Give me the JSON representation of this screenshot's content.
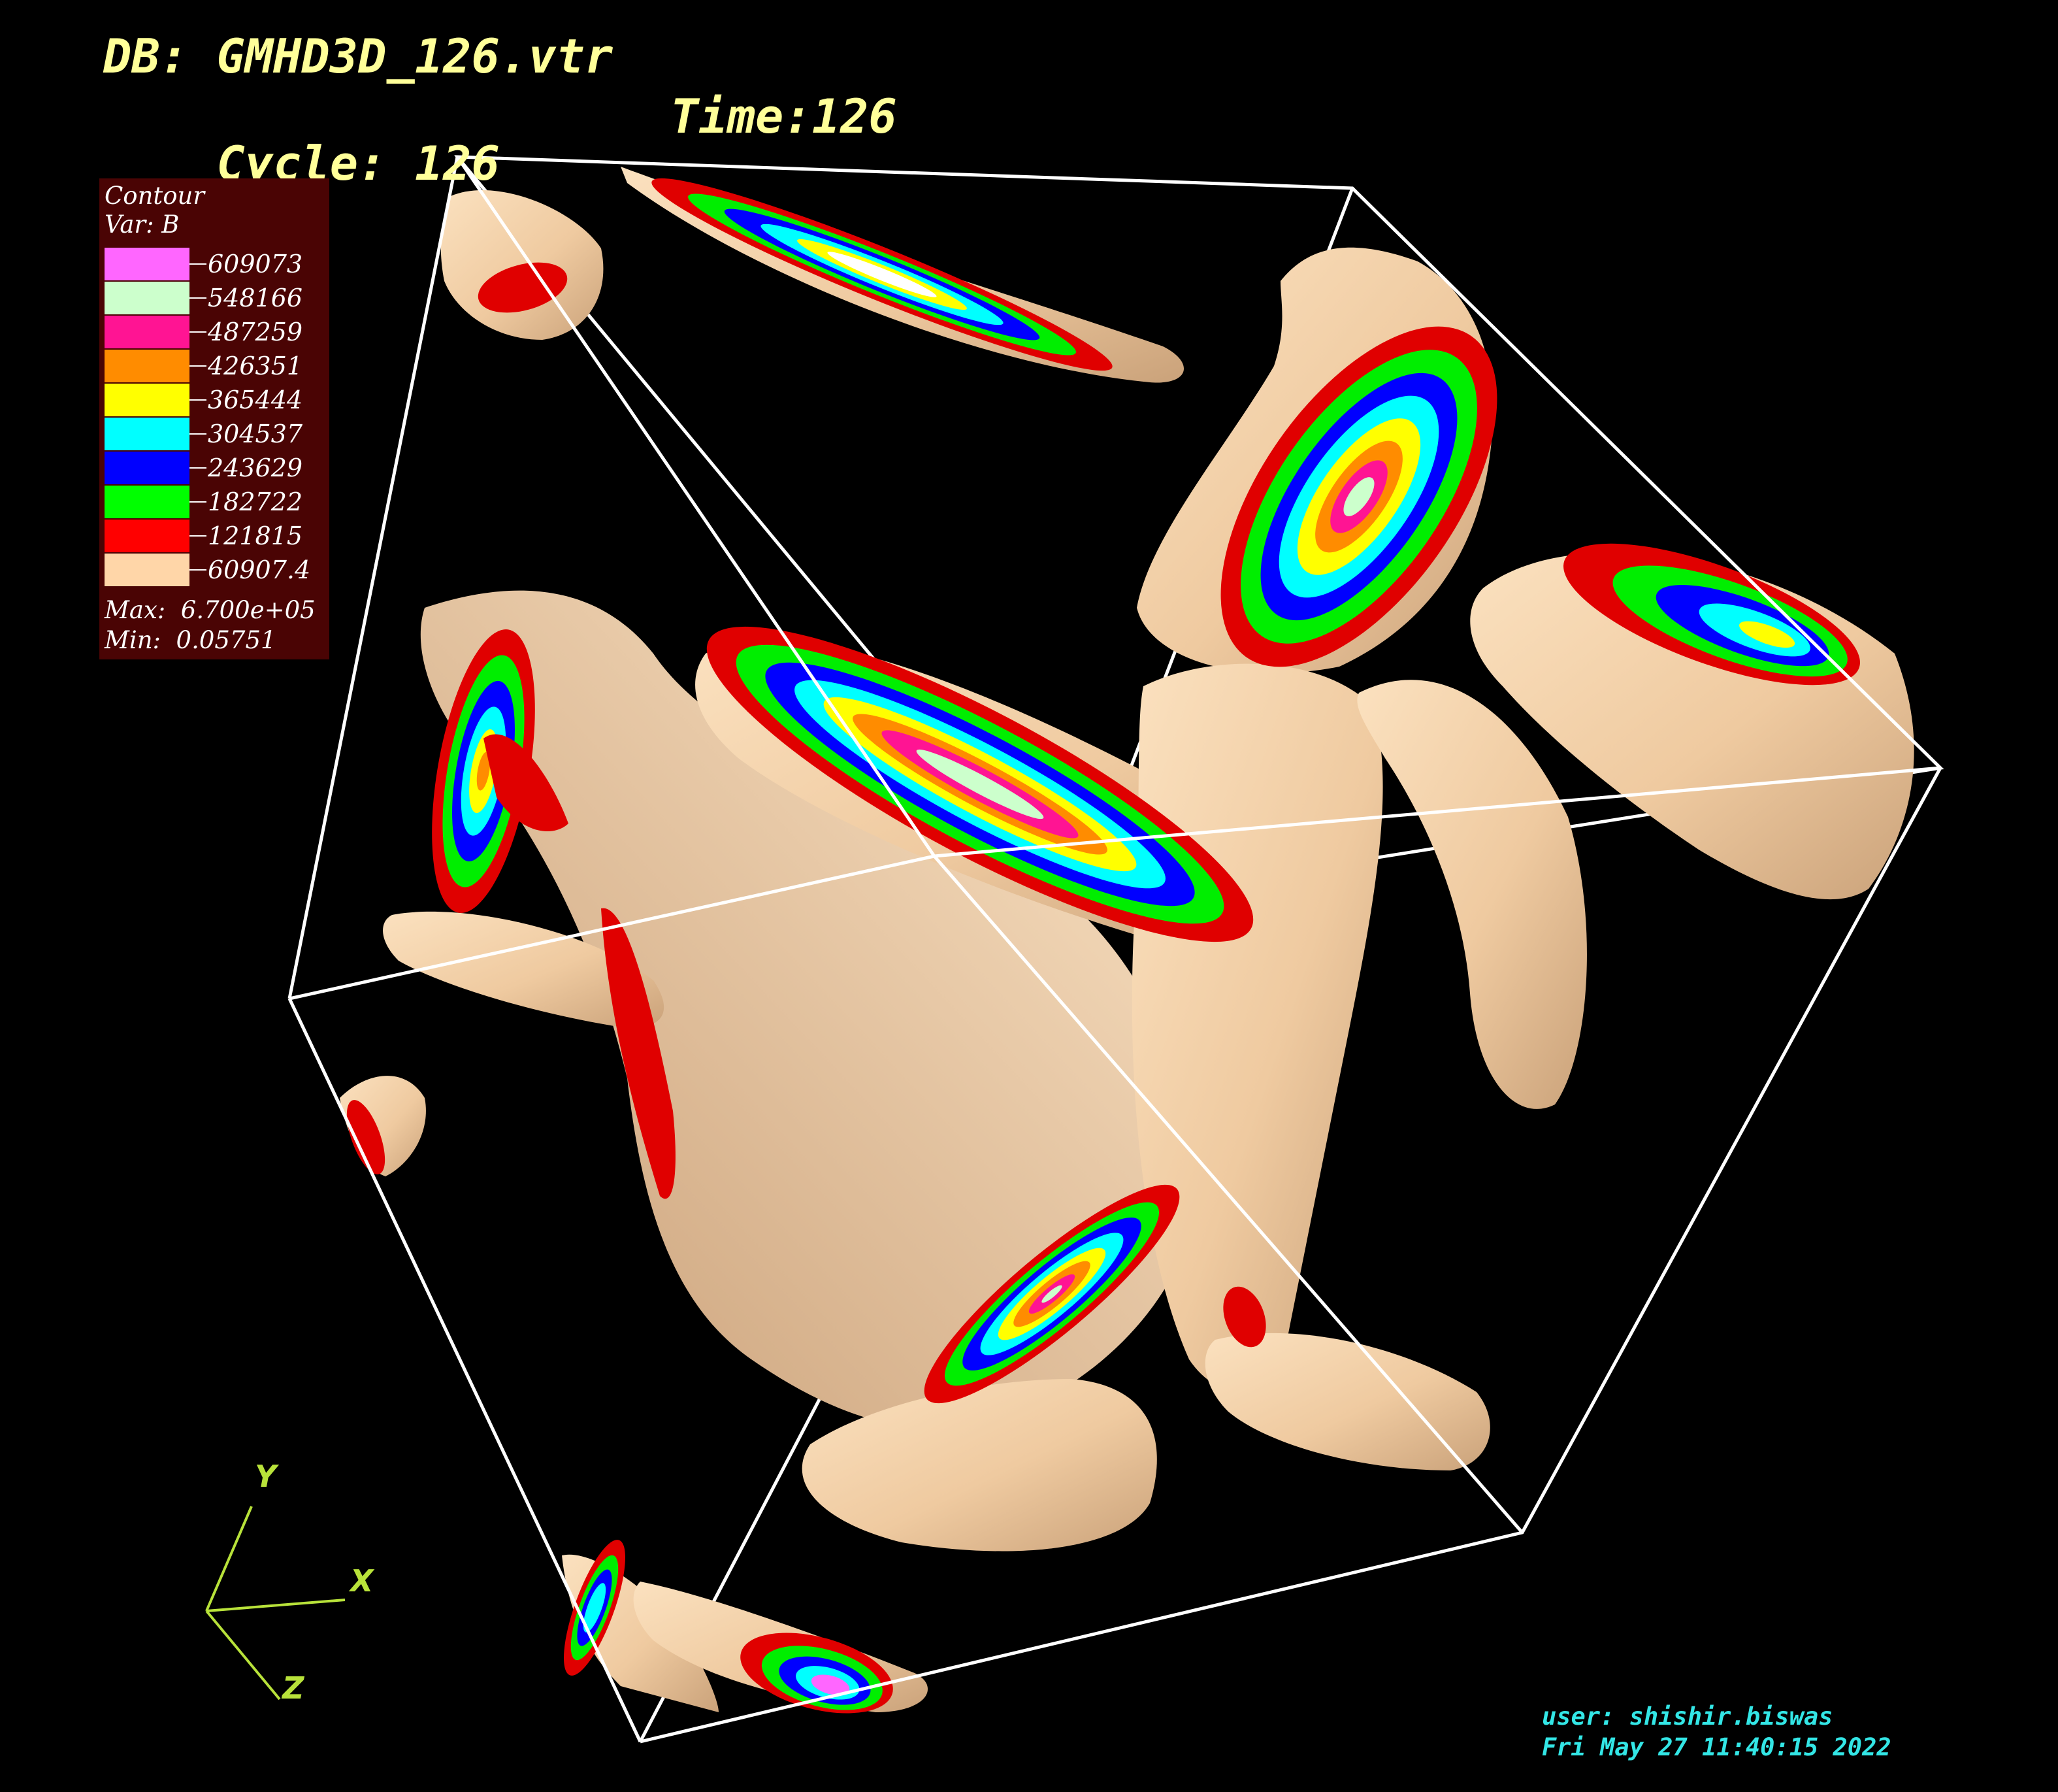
{
  "header": {
    "db_line": "DB: GMHD3D_126.vtr",
    "cycle_line": "Cycle: 126",
    "time_line": "Time:126"
  },
  "legend": {
    "title": "Contour",
    "var": "Var: B",
    "levels": [
      {
        "value": "609073",
        "color": "#ff66ff"
      },
      {
        "value": "548166",
        "color": "#ccffcc"
      },
      {
        "value": "487259",
        "color": "#ff1493"
      },
      {
        "value": "426351",
        "color": "#ff8c00"
      },
      {
        "value": "365444",
        "color": "#ffff00"
      },
      {
        "value": "304537",
        "color": "#00ffff"
      },
      {
        "value": "243629",
        "color": "#0000ff"
      },
      {
        "value": "182722",
        "color": "#00ff00"
      },
      {
        "value": "121815",
        "color": "#ff0000"
      },
      {
        "value": "60907.4",
        "color": "#ffd6a8"
      }
    ],
    "max": "Max:  6.700e+05",
    "min": "Min:  0.05751"
  },
  "axes": {
    "x": "X",
    "y": "Y",
    "z": "Z",
    "color": "#b8e23a"
  },
  "footer": {
    "user": "user: shishir.biswas",
    "date": "Fri May 27 11:40:15 2022"
  },
  "colors": {
    "background": "#000000",
    "surface": "#f5d2a8",
    "box": "#ffffff"
  }
}
